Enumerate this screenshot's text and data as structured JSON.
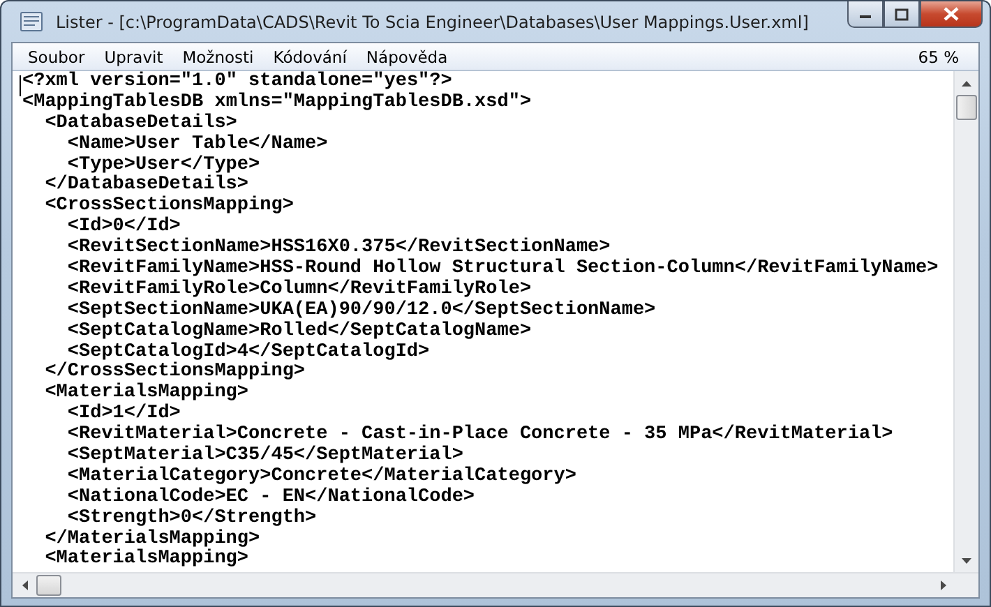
{
  "window": {
    "title": "Lister - [c:\\ProgramData\\CADS\\Revit To Scia Engineer\\Databases\\User Mappings.User.xml]"
  },
  "menu": [
    {
      "label": "Soubor"
    },
    {
      "label": "Upravit"
    },
    {
      "label": "Možnosti"
    },
    {
      "label": "Kódování"
    },
    {
      "label": "Nápověda"
    }
  ],
  "zoom": "65 %",
  "document": [
    {
      "text": "<?xml version=\"1.0\" standalone=\"yes\"?>"
    },
    {
      "text": "<MappingTablesDB xmlns=\"MappingTablesDB.xsd\">",
      "children": [
        {
          "text": "<DatabaseDetails>",
          "children": [
            {
              "text": "<Name>User Table</Name>"
            },
            {
              "text": "<Type>User</Type>"
            }
          ],
          "close": "</DatabaseDetails>"
        },
        {
          "text": "<CrossSectionsMapping>",
          "children": [
            {
              "text": "<Id>0</Id>"
            },
            {
              "text": "<RevitSectionName>HSS16X0.375</RevitSectionName>"
            },
            {
              "text": "<RevitFamilyName>HSS-Round Hollow Structural Section-Column</RevitFamilyName>"
            },
            {
              "text": "<RevitFamilyRole>Column</RevitFamilyRole>"
            },
            {
              "text": "<SeptSectionName>UKA(EA)90/90/12.0</SeptSectionName>"
            },
            {
              "text": "<SeptCatalogName>Rolled</SeptCatalogName>"
            },
            {
              "text": "<SeptCatalogId>4</SeptCatalogId>"
            }
          ],
          "close": "</CrossSectionsMapping>"
        },
        {
          "text": "<MaterialsMapping>",
          "children": [
            {
              "text": "<Id>1</Id>"
            },
            {
              "text": "<RevitMaterial>Concrete - Cast-in-Place Concrete - 35 MPa</RevitMaterial>"
            },
            {
              "text": "<SeptMaterial>C35/45</SeptMaterial>"
            },
            {
              "text": "<MaterialCategory>Concrete</MaterialCategory>"
            },
            {
              "text": "<NationalCode>EC - EN</NationalCode>"
            },
            {
              "text": "<Strength>0</Strength>"
            }
          ],
          "close": "</MaterialsMapping>"
        },
        {
          "text": "<MaterialsMapping>"
        }
      ]
    }
  ]
}
